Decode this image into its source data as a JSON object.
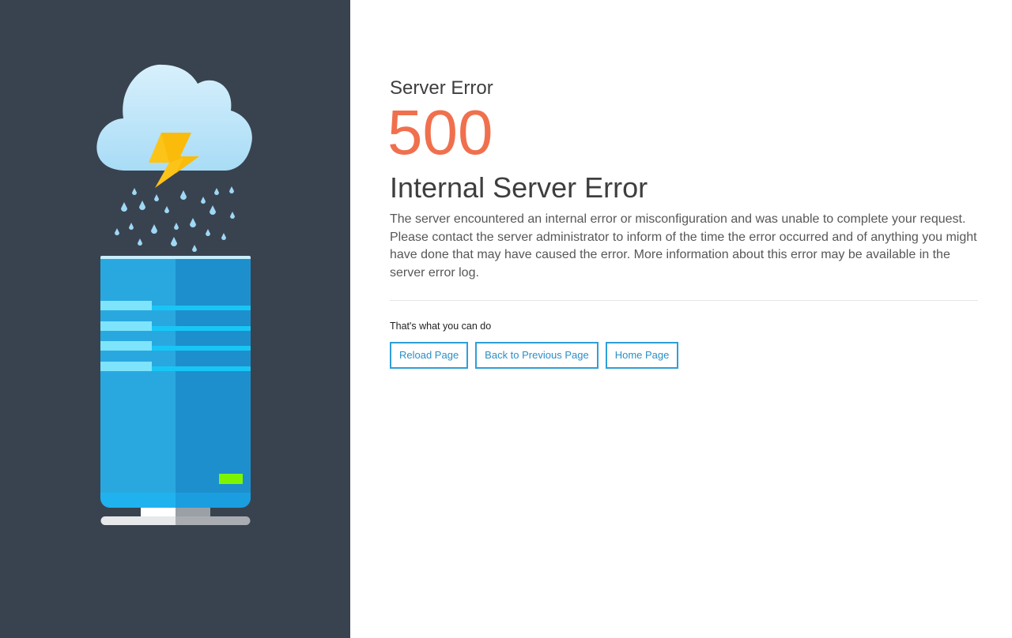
{
  "error": {
    "eyebrow": "Server Error",
    "code": "500",
    "headline": "Internal Server Error",
    "message": "The server encountered an internal error or misconfiguration and was unable to complete your request. Please contact the server administrator to inform of the time the error occurred and of anything you might have done that may have caused the error. More information about this error may be available in the server error log."
  },
  "actions": {
    "title": "That's what you can do",
    "reload_label": "Reload Page",
    "back_label": "Back to Previous Page",
    "home_label": "Home Page"
  },
  "illustration": {
    "icon": "server-in-storm-illustration",
    "colors": {
      "panel_bg": "#39434f",
      "accent_code": "#f0704e",
      "button_border": "#2e9fd8",
      "server_body": "#29a8e0",
      "server_light": "#7ef500",
      "lightning": "#fcc419"
    }
  }
}
